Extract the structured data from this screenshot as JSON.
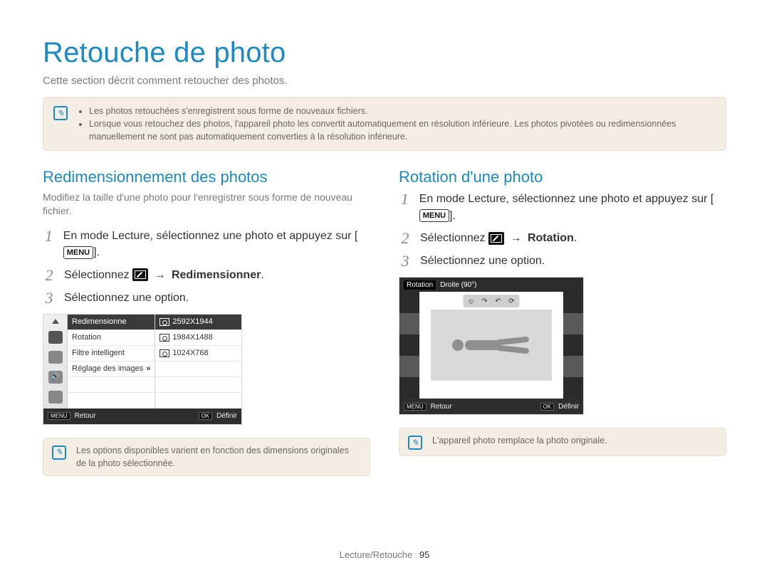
{
  "title": "Retouche de photo",
  "subtitle": "Cette section décrit comment retoucher des photos.",
  "top_note": {
    "bullets": [
      "Les photos retouchées s'enregistrent sous forme de nouveaux fichiers.",
      "Lorsque vous retouchez des photos, l'appareil photo les convertit automatiquement en résolution inférieure. Les photos pivotées ou redimensionnées manuellement ne sont pas automatiquement converties à la résolution inférieure."
    ]
  },
  "menu_button_label": "MENU",
  "left": {
    "heading": "Redimensionnement des photos",
    "lead": "Modifiez la taille d'une photo pour l'enregistrer sous forme de nouveau fichier.",
    "steps": {
      "s1": {
        "num": "1",
        "text_a": "En mode Lecture, sélectionnez une photo et appuyez sur [",
        "text_b": "]."
      },
      "s2": {
        "num": "2",
        "text_a": "Sélectionnez ",
        "arrow": "→",
        "target": "Redimensionner",
        "text_b": "."
      },
      "s3": {
        "num": "3",
        "text": "Sélectionnez une option."
      }
    },
    "screen": {
      "menu_left": [
        "Redimensionne",
        "Rotation",
        "Filtre intelligent",
        "Réglage des images"
      ],
      "menu_right": [
        "2592X1944",
        "1984X1488",
        "1024X768"
      ],
      "footer_back_chip": "MENU",
      "footer_back": "Retour",
      "footer_ok_chip": "OK",
      "footer_ok": "Définir"
    },
    "foot_note": "Les options disponibles varient en fonction des dimensions originales de la photo sélectionnée."
  },
  "right": {
    "heading": "Rotation d'une photo",
    "steps": {
      "s1": {
        "num": "1",
        "text_a": "En mode Lecture, sélectionnez une photo et appuyez sur [",
        "text_b": "]."
      },
      "s2": {
        "num": "2",
        "text_a": "Sélectionnez ",
        "arrow": "→",
        "target": "Rotation",
        "text_b": "."
      },
      "s3": {
        "num": "3",
        "text": "Sélectionnez une option."
      }
    },
    "screen": {
      "top_label": "Rotation",
      "top_value": "Droite (90°)",
      "footer_back_chip": "MENU",
      "footer_back": "Retour",
      "footer_ok_chip": "OK",
      "footer_ok": "Définir"
    },
    "foot_note": "L'appareil photo remplace la photo originale."
  },
  "footer": {
    "section": "Lecture/Retouche",
    "page": "95"
  }
}
